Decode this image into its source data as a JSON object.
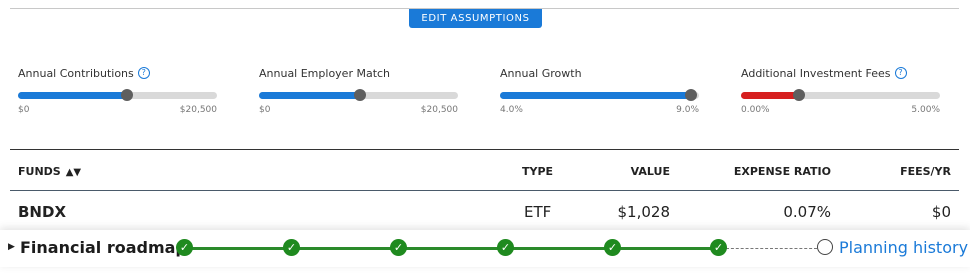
{
  "header": {
    "edit_label": "EDIT ASSUMPTIONS"
  },
  "sliders": [
    {
      "label": "Annual Contributions",
      "help": true,
      "min": "$0",
      "max": "$20,500",
      "fraction": 0.55,
      "fill_color": "#1a7ad8"
    },
    {
      "label": "Annual Employer Match",
      "help": false,
      "min": "$0",
      "max": "$20,500",
      "fraction": 0.51,
      "fill_color": "#1a7ad8"
    },
    {
      "label": "Annual Growth",
      "help": false,
      "min": "4.0%",
      "max": "9.0%",
      "fraction": 0.96,
      "fill_color": "#1a7ad8"
    },
    {
      "label": "Additional Investment Fees",
      "help": true,
      "min": "0.00%",
      "max": "5.00%",
      "fraction": 0.29,
      "fill_color": "#d61f1f"
    }
  ],
  "table": {
    "columns": {
      "funds": "FUNDS",
      "type": "TYPE",
      "value": "VALUE",
      "expense_ratio": "EXPENSE RATIO",
      "fees_per_year": "FEES/YR"
    },
    "rows": [
      {
        "fund": "BNDX",
        "type": "ETF",
        "value": "$1,028",
        "expense_ratio": "0.07%",
        "fees_per_year": "$0"
      }
    ]
  },
  "roadmap": {
    "title": "Financial roadmap",
    "completed_milestones": 6,
    "total_milestones": 7,
    "history_label": "Planning history",
    "complete_color": "#1f8a1f"
  }
}
